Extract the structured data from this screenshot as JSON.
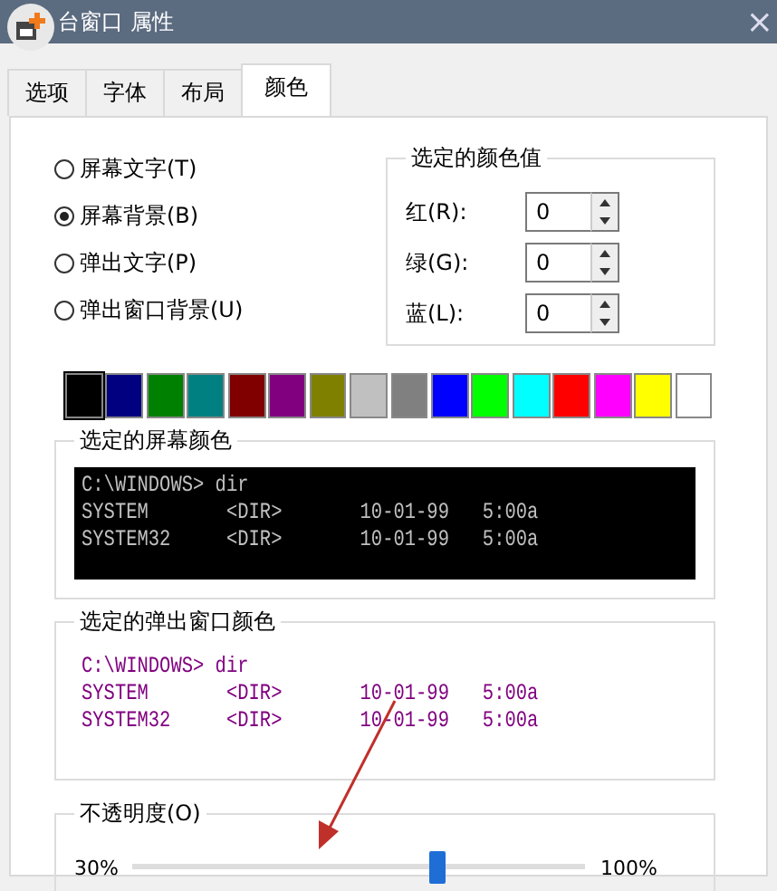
{
  "window": {
    "title": "台窗口 属性",
    "close": "×"
  },
  "tabs": [
    {
      "label": "选项",
      "selected": false
    },
    {
      "label": "字体",
      "selected": false
    },
    {
      "label": "布局",
      "selected": false
    },
    {
      "label": "颜色",
      "selected": true
    }
  ],
  "targets": [
    {
      "label": "屏幕文字(T)",
      "selected": false
    },
    {
      "label": "屏幕背景(B)",
      "selected": true
    },
    {
      "label": "弹出文字(P)",
      "selected": false
    },
    {
      "label": "弹出窗口背景(U)",
      "selected": false
    }
  ],
  "color_values": {
    "title": "选定的颜色值",
    "fields": [
      {
        "label": "红(R):",
        "value": "0"
      },
      {
        "label": "绿(G):",
        "value": "0"
      },
      {
        "label": "蓝(L):",
        "value": "0"
      }
    ]
  },
  "palette": [
    {
      "color": "#000000",
      "selected": true
    },
    {
      "color": "#000080",
      "selected": false
    },
    {
      "color": "#008000",
      "selected": false
    },
    {
      "color": "#008080",
      "selected": false
    },
    {
      "color": "#800000",
      "selected": false
    },
    {
      "color": "#800080",
      "selected": false
    },
    {
      "color": "#808000",
      "selected": false
    },
    {
      "color": "#c0c0c0",
      "selected": false
    },
    {
      "color": "#808080",
      "selected": false
    },
    {
      "color": "#0000ff",
      "selected": false
    },
    {
      "color": "#00ff00",
      "selected": false
    },
    {
      "color": "#00ffff",
      "selected": false
    },
    {
      "color": "#ff0000",
      "selected": false
    },
    {
      "color": "#ff00ff",
      "selected": false
    },
    {
      "color": "#ffff00",
      "selected": false
    },
    {
      "color": "#ffffff",
      "selected": false
    }
  ],
  "screen_preview": {
    "title": "选定的屏幕颜色",
    "lines": [
      "C:\\WINDOWS> dir",
      "SYSTEM       <DIR>       10-01-99   5:00a",
      "SYSTEM32     <DIR>       10-01-99   5:00a"
    ]
  },
  "popup_preview": {
    "title": "选定的弹出窗口颜色",
    "lines": [
      "C:\\WINDOWS> dir",
      "SYSTEM       <DIR>       10-01-99   5:00a",
      "SYSTEM32     <DIR>       10-01-99   5:00a"
    ]
  },
  "opacity": {
    "title": "不透明度(O)",
    "min_label": "30%",
    "max_label": "100%",
    "level": 0.67
  }
}
